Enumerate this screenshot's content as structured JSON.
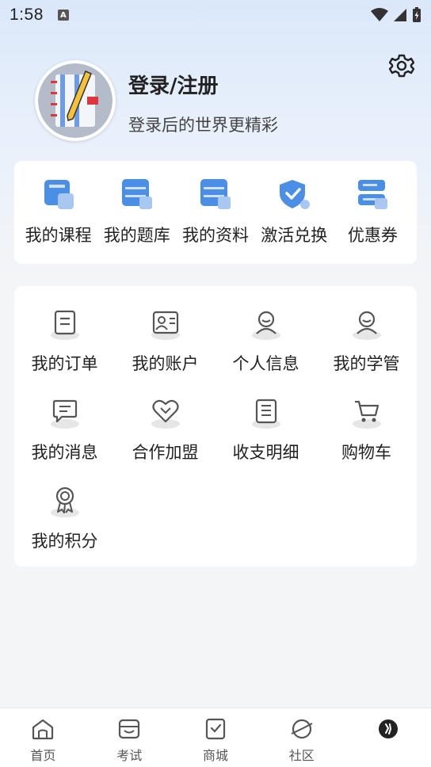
{
  "status_bar": {
    "time": "1:58",
    "notification_icon": "A"
  },
  "profile": {
    "title": "登录/注册",
    "subtitle": "登录后的世界更精彩",
    "avatar_icon": "notebook-pencil-icon"
  },
  "quick_links": [
    {
      "label": "我的课程",
      "icon": "course-icon"
    },
    {
      "label": "我的题库",
      "icon": "question-bank-icon"
    },
    {
      "label": "我的资料",
      "icon": "materials-icon"
    },
    {
      "label": "激活兑换",
      "icon": "shield-check-icon"
    },
    {
      "label": "优惠券",
      "icon": "coupon-icon"
    }
  ],
  "services": [
    {
      "label": "我的订单",
      "icon": "order-icon"
    },
    {
      "label": "我的账户",
      "icon": "account-card-icon"
    },
    {
      "label": "个人信息",
      "icon": "person-icon"
    },
    {
      "label": "我的学管",
      "icon": "tutor-icon"
    },
    {
      "label": "我的消息",
      "icon": "message-icon"
    },
    {
      "label": "合作加盟",
      "icon": "handshake-heart-icon"
    },
    {
      "label": "收支明细",
      "icon": "list-detail-icon"
    },
    {
      "label": "购物车",
      "icon": "cart-icon"
    },
    {
      "label": "我的积分",
      "icon": "medal-icon"
    }
  ],
  "bottom_nav": [
    {
      "label": "首页",
      "icon": "home-icon"
    },
    {
      "label": "考试",
      "icon": "exam-icon"
    },
    {
      "label": "商城",
      "icon": "shop-icon"
    },
    {
      "label": "社区",
      "icon": "planet-icon"
    },
    {
      "label": "",
      "icon": "profile-avatar-icon"
    }
  ],
  "colors": {
    "accent_blue": "#4a8ee6",
    "light_blue": "#a9c8f1",
    "icon_gray": "#555555"
  }
}
